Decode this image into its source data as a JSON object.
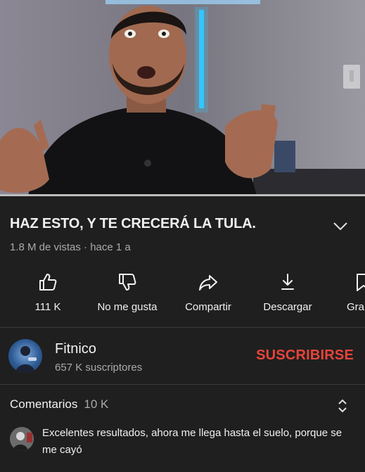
{
  "video": {
    "title": "HAZ ESTO, Y TE CRECERÁ LA TULA.",
    "meta": "1.8 M de vistas · hace 1 a",
    "progress": 1.0
  },
  "actions": {
    "like": {
      "label": "111 K",
      "icon": "thumbs-up-icon"
    },
    "dislike": {
      "label": "No me gusta",
      "icon": "thumbs-down-icon"
    },
    "share": {
      "label": "Compartir",
      "icon": "share-icon"
    },
    "download": {
      "label": "Descargar",
      "icon": "download-icon"
    },
    "save": {
      "label": "Gra",
      "icon": "bookmark-icon"
    }
  },
  "channel": {
    "name": "Fitnico",
    "subscribers": "657 K suscriptores",
    "subscribe_label": "SUSCRIBIRSE",
    "subscribe_color": "#e8443a"
  },
  "comments": {
    "heading": "Comentarios",
    "count": "10 K",
    "top_comment": "Excelentes resultados, ahora me llega hasta el suelo, porque se me cayó"
  }
}
